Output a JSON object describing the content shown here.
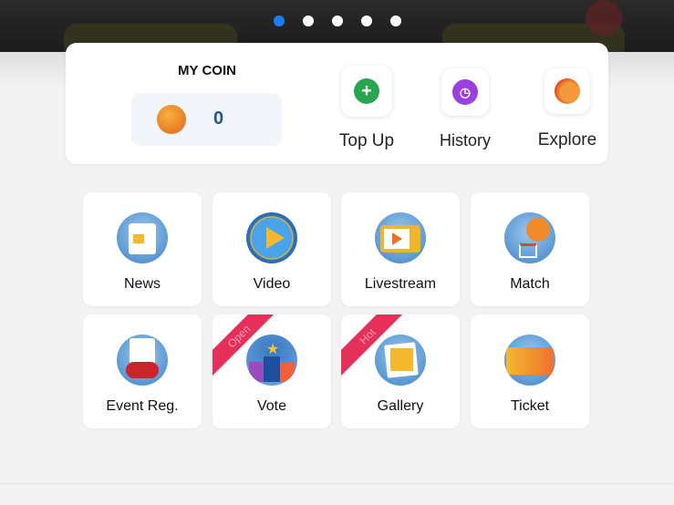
{
  "carousel": {
    "pages": 5,
    "active_index": 0,
    "active_color": "#1e7cf2"
  },
  "coin": {
    "title": "MY COIN",
    "balance": "0"
  },
  "actions": [
    {
      "label": "Top Up",
      "icon": "plus-circle-icon",
      "color": "#2aa54f"
    },
    {
      "label": "History",
      "icon": "clock-icon",
      "color": "#9b3fe0"
    },
    {
      "label": "Explore",
      "icon": "flaming-basketball-icon",
      "color": "#f0702a"
    }
  ],
  "menu": [
    {
      "label": "News",
      "icon": "newspaper-icon"
    },
    {
      "label": "Video",
      "icon": "play-icon"
    },
    {
      "label": "Livestream",
      "icon": "tv-icon"
    },
    {
      "label": "Match",
      "icon": "basketball-hoop-icon"
    },
    {
      "label": "Event Reg.",
      "icon": "whistle-icon"
    },
    {
      "label": "Vote",
      "icon": "podium-star-icon",
      "badge": "Open"
    },
    {
      "label": "Gallery",
      "icon": "photos-icon",
      "badge": "Hot"
    },
    {
      "label": "Ticket",
      "icon": "ticket-icon"
    }
  ],
  "badge_color": "#e5305a"
}
